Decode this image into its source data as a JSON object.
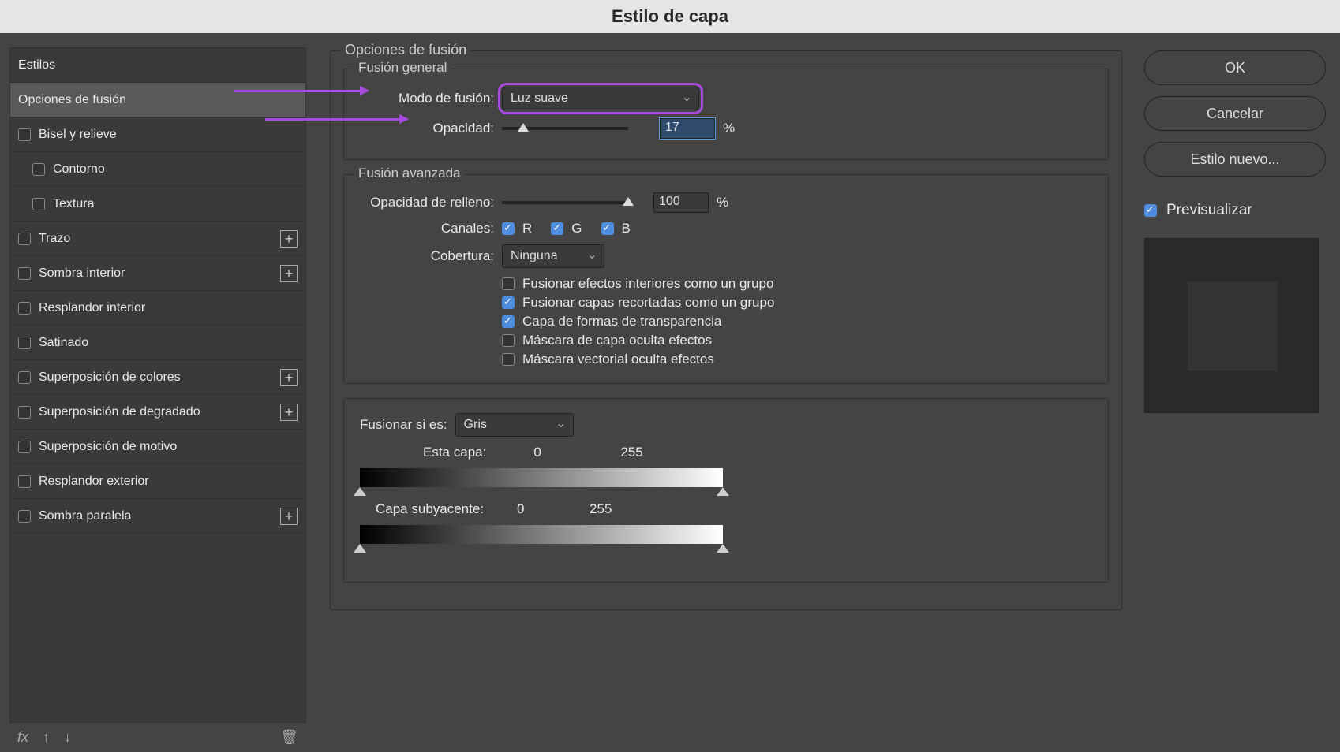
{
  "title": "Estilo de capa",
  "sidebar": {
    "styles_header": "Estilos",
    "items": [
      {
        "label": "Opciones de fusión",
        "selected": true,
        "check": null
      },
      {
        "label": "Bisel y relieve",
        "check": false
      },
      {
        "label": "Contorno",
        "check": false,
        "sub": true
      },
      {
        "label": "Textura",
        "check": false,
        "sub": true
      },
      {
        "label": "Trazo",
        "check": false,
        "add": true
      },
      {
        "label": "Sombra interior",
        "check": false,
        "add": true
      },
      {
        "label": "Resplandor interior",
        "check": false
      },
      {
        "label": "Satinado",
        "check": false
      },
      {
        "label": "Superposición de colores",
        "check": false,
        "add": true
      },
      {
        "label": "Superposición de degradado",
        "check": false,
        "add": true
      },
      {
        "label": "Superposición de motivo",
        "check": false
      },
      {
        "label": "Resplandor exterior",
        "check": false
      },
      {
        "label": "Sombra paralela",
        "check": false,
        "add": true
      }
    ],
    "footer": {
      "fx": "fx",
      "up": "↑",
      "down": "↓",
      "trash": "🗑"
    }
  },
  "options": {
    "legend": "Opciones de fusión",
    "general": {
      "legend": "Fusión general",
      "blend_mode_label": "Modo de fusión:",
      "blend_mode_value": "Luz suave",
      "opacity_label": "Opacidad:",
      "opacity_value": "17",
      "opacity_pct_pos": 10,
      "pct": "%"
    },
    "advanced": {
      "legend": "Fusión avanzada",
      "fill_opacity_label": "Opacidad de relleno:",
      "fill_opacity_value": "100",
      "channels_label": "Canales:",
      "ch_r": "R",
      "ch_g": "G",
      "ch_b": "B",
      "coverage_label": "Cobertura:",
      "coverage_value": "Ninguna",
      "opts": [
        {
          "label": "Fusionar efectos interiores como un grupo",
          "checked": false
        },
        {
          "label": "Fusionar capas recortadas como un grupo",
          "checked": true
        },
        {
          "label": "Capa de formas de transparencia",
          "checked": true
        },
        {
          "label": "Máscara de capa oculta efectos",
          "checked": false
        },
        {
          "label": "Máscara vectorial oculta efectos",
          "checked": false
        }
      ]
    },
    "blendif": {
      "label": "Fusionar si es:",
      "value": "Gris",
      "this_layer_label": "Esta capa:",
      "this_layer_lo": "0",
      "this_layer_hi": "255",
      "under_layer_label": "Capa subyacente:",
      "under_layer_lo": "0",
      "under_layer_hi": "255"
    }
  },
  "buttons": {
    "ok": "OK",
    "cancel": "Cancelar",
    "new_style": "Estilo nuevo...",
    "preview": "Previsualizar"
  }
}
